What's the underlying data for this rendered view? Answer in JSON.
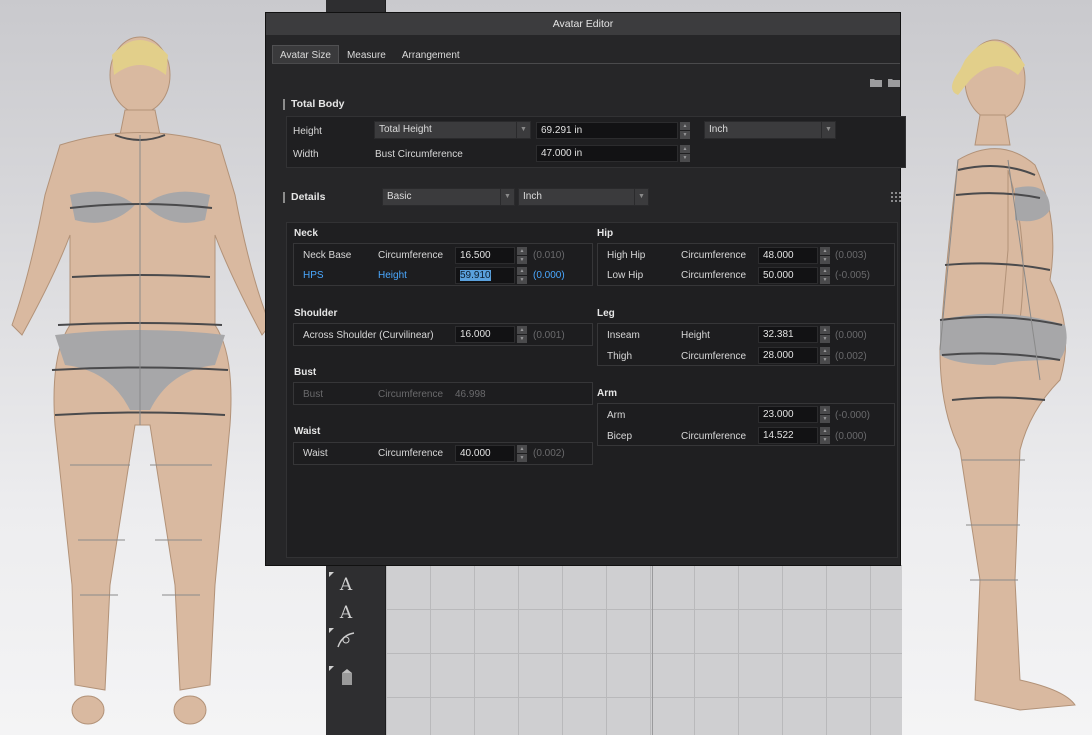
{
  "dialog": {
    "title": "Avatar Editor",
    "tabs": [
      {
        "label": "Avatar Size",
        "active": true
      },
      {
        "label": "Measure",
        "active": false
      },
      {
        "label": "Arrangement",
        "active": false
      }
    ]
  },
  "total_body": {
    "header": "Total Body",
    "height_label": "Height",
    "height_type": "Total Height",
    "height_value": "69.291 in",
    "unit": "Inch",
    "width_label": "Width",
    "width_type": "Bust Circumference",
    "width_value": "47.000 in"
  },
  "details": {
    "header": "Details",
    "mode": "Basic",
    "unit": "Inch"
  },
  "neck": {
    "title": "Neck",
    "rows": [
      {
        "name": "Neck Base",
        "type": "Circumference",
        "value": "16.500",
        "delta": "(0.010)"
      },
      {
        "name": "HPS",
        "type": "Height",
        "value": "59.910",
        "delta": "(0.000)"
      }
    ]
  },
  "shoulder": {
    "title": "Shoulder",
    "rows": [
      {
        "name": "Across Shoulder (Curvilinear)",
        "value": "16.000",
        "delta": "(0.001)"
      }
    ]
  },
  "bust": {
    "title": "Bust",
    "rows": [
      {
        "name": "Bust",
        "type": "Circumference",
        "value": "46.998"
      }
    ]
  },
  "waist": {
    "title": "Waist",
    "rows": [
      {
        "name": "Waist",
        "type": "Circumference",
        "value": "40.000",
        "delta": "(0.002)"
      }
    ]
  },
  "hip": {
    "title": "Hip",
    "rows": [
      {
        "name": "High Hip",
        "type": "Circumference",
        "value": "48.000",
        "delta": "(0.003)"
      },
      {
        "name": "Low Hip",
        "type": "Circumference",
        "value": "50.000",
        "delta": "(-0.005)"
      }
    ]
  },
  "leg": {
    "title": "Leg",
    "rows": [
      {
        "name": "Inseam",
        "type": "Height",
        "value": "32.381",
        "delta": "(0.000)"
      },
      {
        "name": "Thigh",
        "type": "Circumference",
        "value": "28.000",
        "delta": "(0.002)"
      }
    ]
  },
  "arm": {
    "title": "Arm",
    "rows": [
      {
        "name": "Arm",
        "value": "23.000",
        "delta": "(-0.000)"
      },
      {
        "name": "Bicep",
        "type": "Circumference",
        "value": "14.522",
        "delta": "(0.000)"
      }
    ]
  },
  "toolbar": {
    "tools": [
      "text-tool-icon",
      "text-tool-alt-icon",
      "measure-curve-icon",
      "stamp-icon"
    ],
    "glyphs": {
      "text": "A"
    }
  }
}
